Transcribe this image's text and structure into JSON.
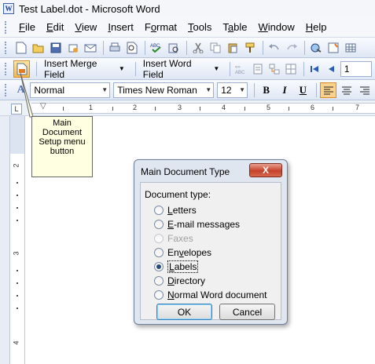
{
  "window": {
    "title": "Test Label.dot - Microsoft Word",
    "icon_letter": "W"
  },
  "menu": [
    {
      "acc": "F",
      "rest": "ile"
    },
    {
      "acc": "E",
      "rest": "dit"
    },
    {
      "acc": "V",
      "rest": "iew"
    },
    {
      "acc": "I",
      "rest": "nsert"
    },
    {
      "pre": "F",
      "acc": "o",
      "rest": "rmat"
    },
    {
      "acc": "T",
      "rest": "ools"
    },
    {
      "pre": "T",
      "acc": "a",
      "rest": "ble"
    },
    {
      "acc": "W",
      "rest": "indow"
    },
    {
      "acc": "H",
      "rest": "elp"
    }
  ],
  "mail_merge_toolbar": {
    "insert_merge_field": "Insert Merge Field",
    "insert_word_field": "Insert Word Field",
    "record_number": "1"
  },
  "formatting_toolbar": {
    "style": "Normal",
    "font": "Times New Roman",
    "size": "12"
  },
  "ruler": {
    "h_numbers": [
      "1",
      "2",
      "3",
      "4",
      "5",
      "6",
      "7"
    ],
    "v_numbers": [
      "2",
      "3",
      "4"
    ]
  },
  "callout": {
    "lines": [
      "Main",
      "Document",
      "Setup menu",
      "button"
    ]
  },
  "dialog": {
    "title": "Main Document Type",
    "close_glyph": "X",
    "group_label": "Document type:",
    "options": [
      {
        "pre": "",
        "acc": "L",
        "rest": "etters",
        "checked": false,
        "disabled": false
      },
      {
        "pre": "",
        "acc": "E",
        "rest": "-mail messages",
        "checked": false,
        "disabled": false
      },
      {
        "pre": "Fa",
        "acc": "",
        "rest": "xes",
        "checked": false,
        "disabled": true
      },
      {
        "pre": "En",
        "acc": "v",
        "rest": "elopes",
        "checked": false,
        "disabled": false
      },
      {
        "pre": "",
        "acc": "L",
        "rest": "abels",
        "checked": true,
        "disabled": false
      },
      {
        "pre": "",
        "acc": "D",
        "rest": "irectory",
        "checked": false,
        "disabled": false
      },
      {
        "pre": "",
        "acc": "N",
        "rest": "ormal Word document",
        "checked": false,
        "disabled": false
      }
    ],
    "ok_label": "OK",
    "cancel_label": "Cancel"
  },
  "colors": {
    "highlight_orange": "#f5b84c",
    "dialog_close_red": "#c6412a",
    "tooltip_yellow": "#ffffe1"
  }
}
